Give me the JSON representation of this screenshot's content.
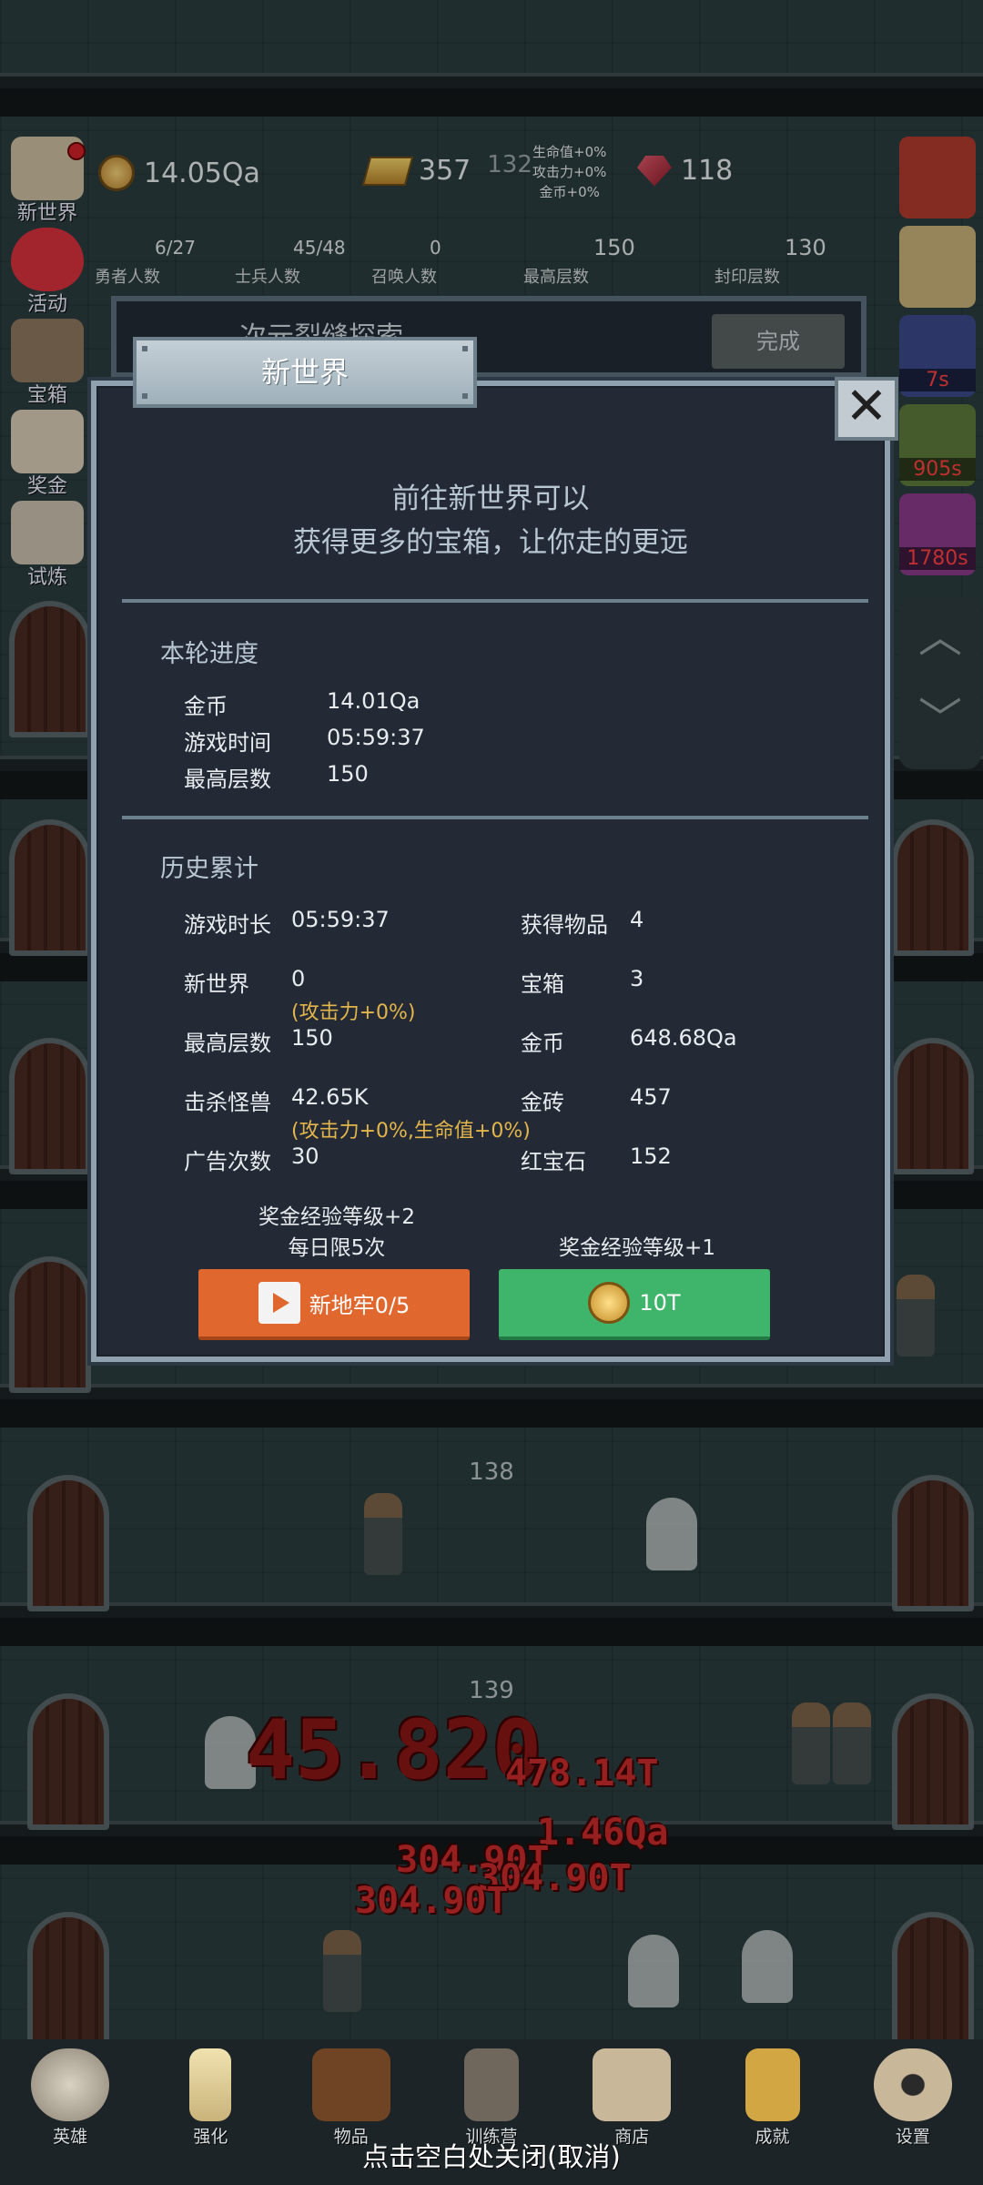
{
  "hud": {
    "coins": "14.05Qa",
    "gold_bars": "357",
    "gold_bars_extra": "132",
    "bonus_lines": [
      "生命值+0%",
      "攻击力+0%",
      "金币+0%"
    ],
    "rubies": "118",
    "heroes": {
      "value": "6/27",
      "label": "勇者人数"
    },
    "soldiers": {
      "value": "45/48",
      "label": "士兵人数"
    },
    "summoned": {
      "value": "0",
      "label": "召唤人数"
    },
    "max_floor": {
      "value": "150",
      "label": "最高层数"
    },
    "sealed_floor": {
      "value": "130",
      "label": "封印层数"
    }
  },
  "left_menu": [
    "新世界",
    "活动",
    "宝箱",
    "奖金",
    "试炼"
  ],
  "right_menu_timers": [
    "7s",
    "905s",
    "1780s"
  ],
  "quest": {
    "title": "次元裂缝探索",
    "button": "完成"
  },
  "modal": {
    "title": "新世界",
    "intro_line1": "前往新世界可以",
    "intro_line2": "获得更多的宝箱，让你走的更远",
    "round_title": "本轮进度",
    "round": [
      {
        "k": "金币",
        "v": "14.01Qa"
      },
      {
        "k": "游戏时间",
        "v": "05:59:37"
      },
      {
        "k": "最高层数",
        "v": "150"
      }
    ],
    "history_title": "历史累计",
    "history_left": [
      {
        "k": "游戏时长",
        "v": "05:59:37"
      },
      {
        "k": "新世界",
        "v": "0"
      },
      {
        "k": "最高层数",
        "v": "150"
      },
      {
        "k": "击杀怪兽",
        "v": "42.65K"
      },
      {
        "k": "广告次数",
        "v": "30"
      }
    ],
    "history_right": [
      {
        "k": "获得物品",
        "v": "4"
      },
      {
        "k": "宝箱",
        "v": "3"
      },
      {
        "k": "金币",
        "v": "648.68Qa"
      },
      {
        "k": "金砖",
        "v": "457"
      },
      {
        "k": "红宝石",
        "v": "152"
      }
    ],
    "note_newworld": "(攻击力+0%)",
    "note_kills": "(攻击力+0%,生命值+0%)",
    "left_caption_1": "奖金经验等级+2",
    "left_caption_2": "每日限5次",
    "right_caption": "奖金经验等级+1",
    "btn_dungeon": "新地牢0/5",
    "btn_coin": "10T"
  },
  "floors": [
    "138",
    "139"
  ],
  "damage_numbers": [
    "45.820",
    "478.14T",
    "1.46Qa",
    "304.90T",
    "304.90T",
    "304.90T"
  ],
  "bottom_nav": [
    "英雄",
    "强化",
    "物品",
    "训练营",
    "商店",
    "成就",
    "设置"
  ],
  "close_hint": "点击空白处关闭(取消)",
  "colors": {
    "accent_orange": "#e0672e",
    "accent_green": "#3fb56b",
    "note_gold": "#e3b54a",
    "damage_red": "#c92a2a"
  }
}
